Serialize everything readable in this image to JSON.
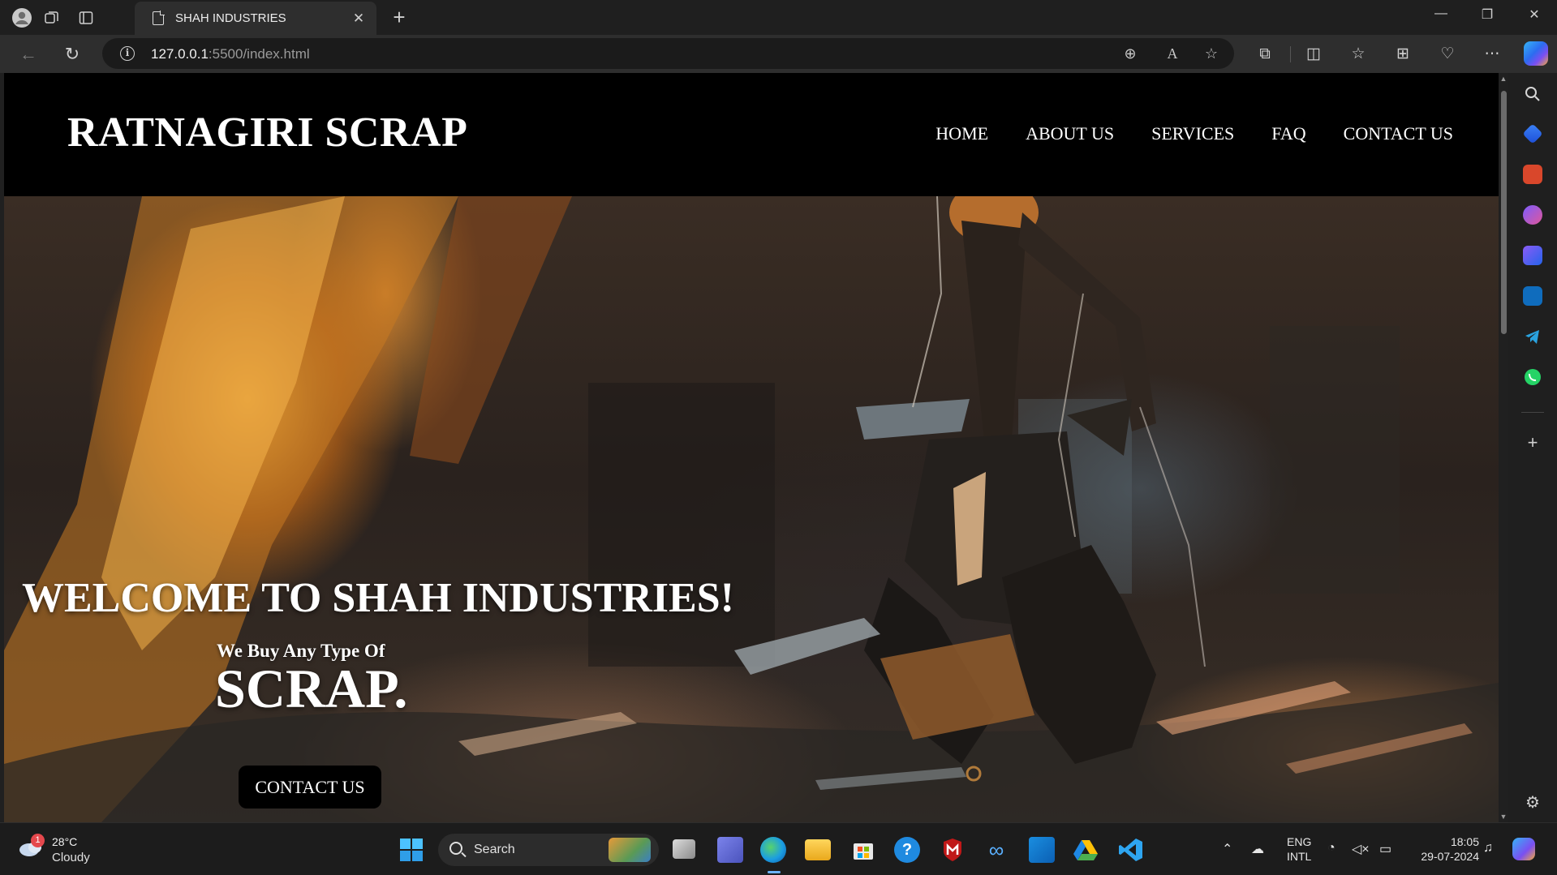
{
  "browser": {
    "tab_title": "SHAH INDUSTRIES",
    "url_host": "127.0.0.1",
    "url_path": ":5500/index.html"
  },
  "site": {
    "brand": "RATNAGIRI SCRAP",
    "nav": [
      "HOME",
      "ABOUT US",
      "SERVICES",
      "FAQ",
      "CONTACT US"
    ],
    "hero": {
      "title": "WELCOME TO SHAH INDUSTRIES!",
      "subtitle": "We Buy Any Type Of",
      "word": "SCRAP.",
      "cta": "CONTACT US"
    }
  },
  "taskbar": {
    "weather_temp": "28°C",
    "weather_desc": "Cloudy",
    "weather_badge": "1",
    "search_label": "Search",
    "lang_1": "ENG",
    "lang_2": "INTL",
    "time": "18:05",
    "date": "29-07-2024"
  },
  "colors": {
    "header_bg": "#000000",
    "hero_accent": "#f0a030",
    "browser_bg": "#1f1f1f"
  }
}
